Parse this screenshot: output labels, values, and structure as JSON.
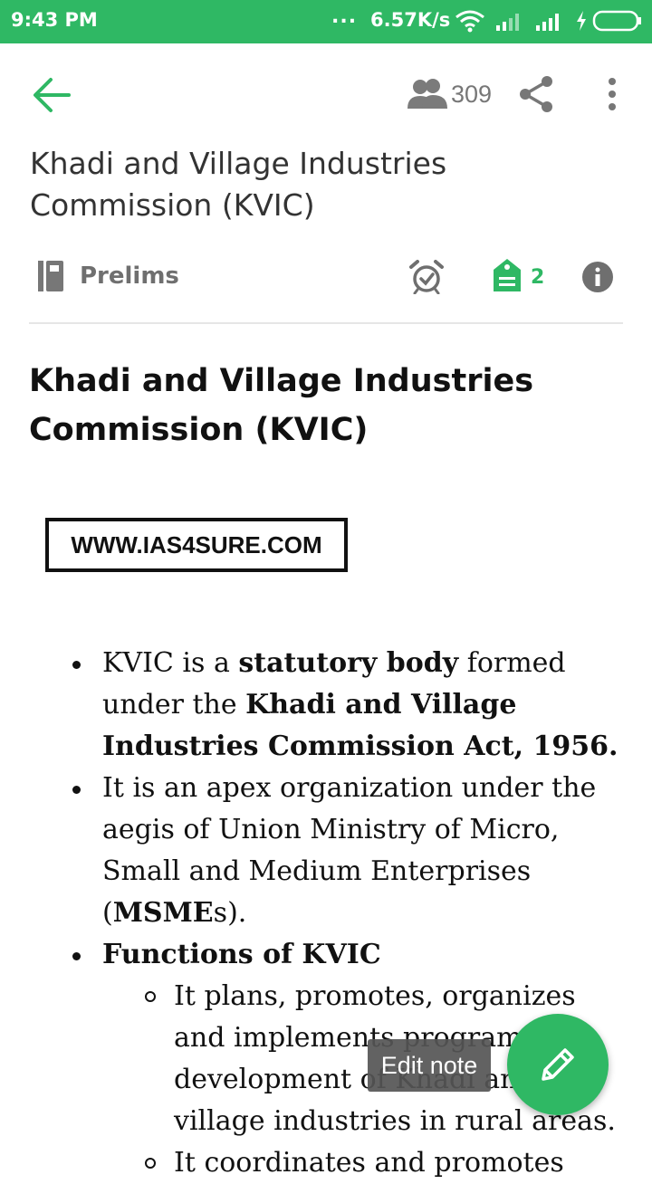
{
  "status_bar": {
    "time": "9:43 PM",
    "dots": "...",
    "net_speed": "6.57K/s"
  },
  "app_bar": {
    "viewer_count": "309"
  },
  "note": {
    "title": "Khadi and Village Industries Commission (KVIC)",
    "notebook": "Prelims",
    "tag_count": "2"
  },
  "content": {
    "heading": "Khadi and Village Industries Commission (KVIC)",
    "banner_text": "WWW.IAS4SURE.COM",
    "bullet1": {
      "pre": "KVIC is a ",
      "bold1": "statutory body",
      "mid": " formed under the ",
      "bold2": "Khadi and Village Industries Commission Act, 1956."
    },
    "bullet2": {
      "pre": "It is an apex organization under the aegis of Union Ministry of Micro, Small and Medium Enterprises (",
      "bold": "MSME",
      "post": "s)."
    },
    "bullet3": {
      "label": "Functions of KVIC",
      "sub1": "It plans, promotes, organizes and implements programs for development of Khadi and village industries in rural areas.",
      "sub2_partial": "It coordinates and promotes"
    }
  },
  "tooltip": "Edit note",
  "colors": {
    "accent": "#2fb864",
    "status_bar": "#2fb864"
  },
  "icons": [
    "back-arrow-icon",
    "viewers-icon",
    "share-icon",
    "more-vert-icon",
    "notebook-icon",
    "alarm-icon",
    "tag-icon",
    "info-icon",
    "pencil-icon"
  ]
}
